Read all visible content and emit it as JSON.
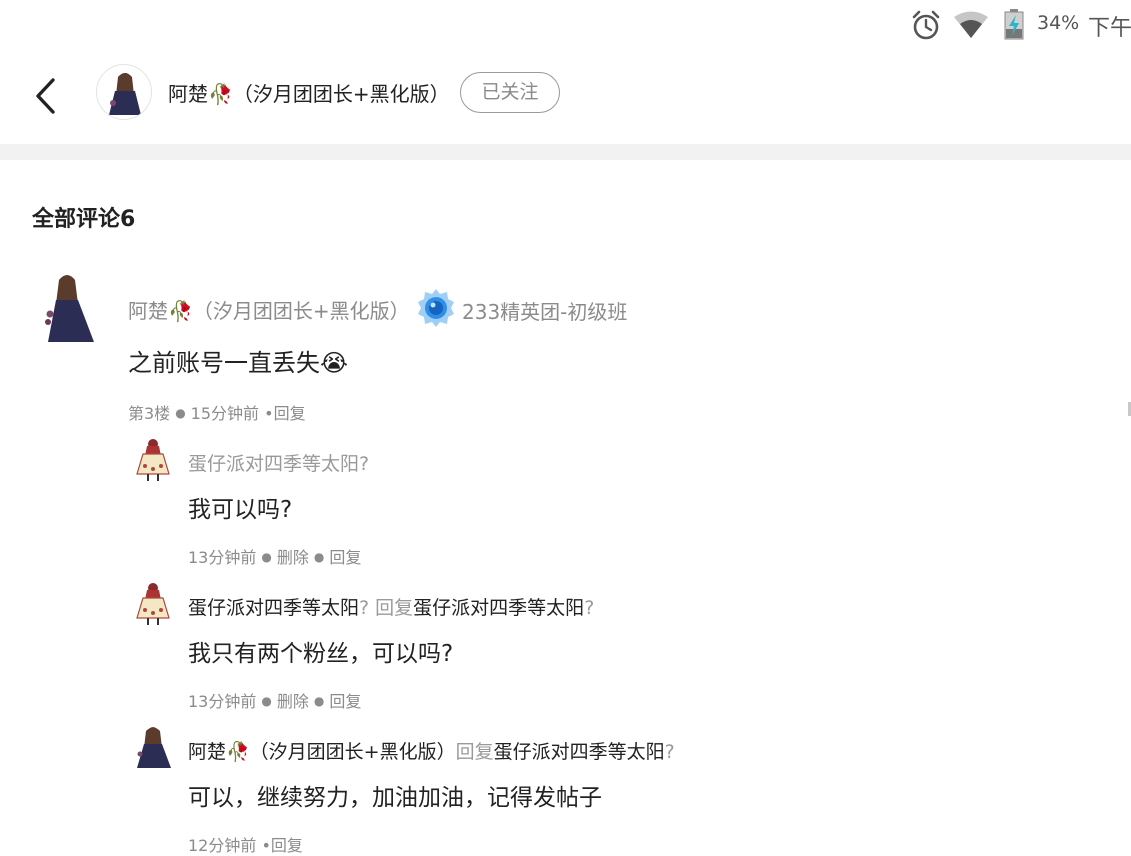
{
  "status_bar": {
    "battery_percent": "34%",
    "time": "下午",
    "icons": [
      "alarm-icon",
      "wifi-icon",
      "battery-charging-icon"
    ]
  },
  "header": {
    "author_name": "阿楚🥀（汐月团团长+黑化版）",
    "follow_label": "已关注",
    "icons": [
      "back-arrow-icon"
    ]
  },
  "comments": {
    "title": "全部评论6",
    "main": {
      "author": "阿楚🥀（汐月团团长+黑化版）",
      "badge_label": "233精英团-初级班",
      "content": "之前账号一直丢失😭",
      "floor": "第3楼",
      "time": "15分钟前",
      "reply_label": "•回复"
    },
    "replies": [
      {
        "author": "蛋仔派对四季等太阳",
        "author_suffix": "?",
        "reply_prefix": "",
        "reply_to": "",
        "reply_to_suffix": "",
        "content": "我可以吗?",
        "time": "13分钟前",
        "delete_label": "删除",
        "reply_label": "回复"
      },
      {
        "author": "蛋仔派对四季等太阳",
        "author_suffix": "?",
        "reply_prefix": "回复",
        "reply_to": "蛋仔派对四季等太阳",
        "reply_to_suffix": "?",
        "content": "我只有两个粉丝，可以吗?",
        "time": "13分钟前",
        "delete_label": "删除",
        "reply_label": "回复"
      },
      {
        "author": "阿楚🥀（汐月团团长+黑化版）",
        "reply_prefix": "回复",
        "reply_to": "蛋仔派对四季等太阳",
        "reply_to_suffix": "?",
        "content": "可以，继续努力，加油加油，记得发帖子",
        "time": "12分钟前",
        "reply_label": "•回复"
      }
    ]
  },
  "colors": {
    "primary_text": "#222222",
    "secondary_text": "#8b8b8b",
    "divider": "#f2f2f2",
    "badge_blue": "#2f8fe8"
  }
}
